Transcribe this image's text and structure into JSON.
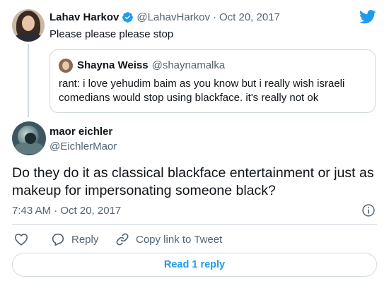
{
  "parent_tweet": {
    "name": "Lahav Harkov",
    "handle": "@LahavHarkov",
    "separator": "·",
    "date": "Oct 20, 2017",
    "text": "Please please please stop"
  },
  "quoted_tweet": {
    "name": "Shayna Weiss",
    "handle": "@shaynamalka",
    "text": "rant: i love yehudim baim as you know but i really wish israeli comedians would stop using blackface. it's really not ok"
  },
  "main_tweet": {
    "name": "maor eichler",
    "handle": "@EichlerMaor",
    "text": "Do they do it as classical blackface entertainment or just as makeup for impersonating someone black?",
    "timestamp": "7:43 AM · Oct 20, 2017"
  },
  "actions": {
    "reply_label": "Reply",
    "copy_label": "Copy link to Tweet"
  },
  "read_replies_label": "Read 1 reply",
  "colors": {
    "accent": "#1d9bf0",
    "muted_text": "#536471",
    "border": "#cfd9de"
  },
  "icons": [
    "verified-badge-icon",
    "twitter-bird-icon",
    "info-icon",
    "heart-icon",
    "reply-icon",
    "link-icon"
  ]
}
